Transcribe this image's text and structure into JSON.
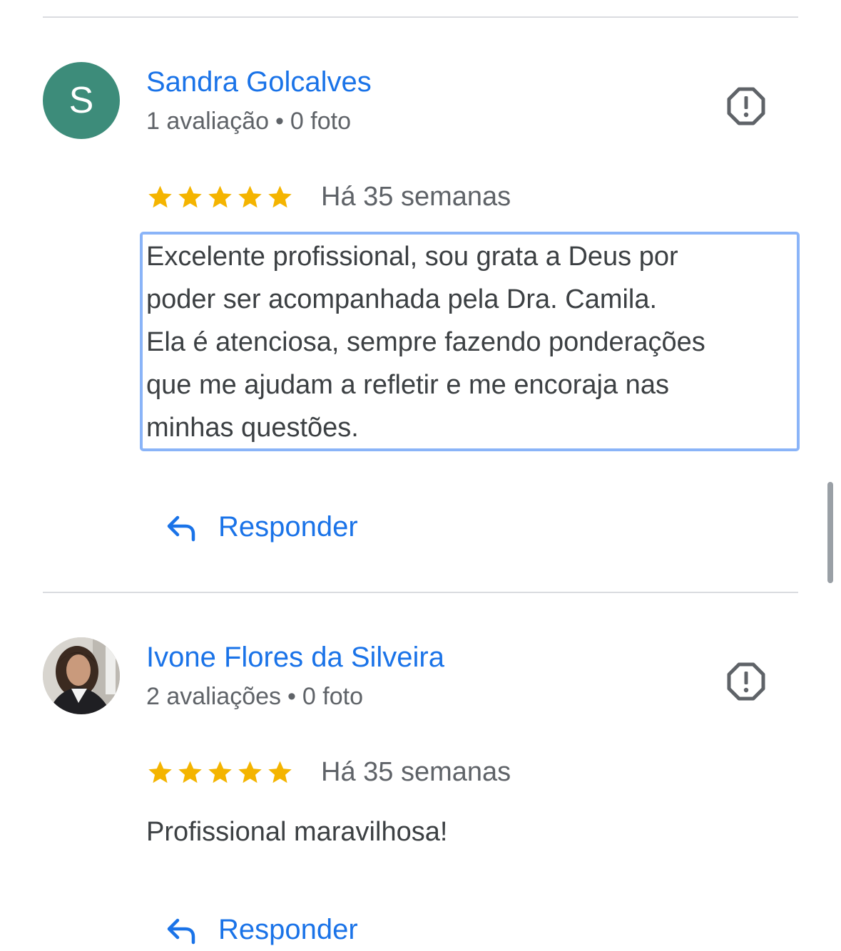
{
  "reviews": [
    {
      "reviewer_name": "Sandra Golcalves",
      "avatar_letter": "S",
      "avatar_color": "#3d8c7a",
      "reviews_count": "1 avaliação",
      "separator": "•",
      "photos_count": "0 foto",
      "rating": 5,
      "time_ago": "Há 35 semanas",
      "text_lines": [
        "Excelente profissional, sou grata a Deus por",
        "poder ser acompanhada pela Dra. Camila.",
        "Ela é atenciosa, sempre fazendo ponderações",
        "que me ajudam a refletir e me encoraja nas",
        "minhas questões."
      ],
      "reply_label": "Responder",
      "flag_icon": "flag-icon"
    },
    {
      "reviewer_name": "Ivone Flores da Silveira",
      "avatar_type": "photo",
      "reviews_count": "2 avaliações",
      "separator": "•",
      "photos_count": "0 foto",
      "rating": 5,
      "time_ago": "Há 35 semanas",
      "text_lines": [
        "Profissional maravilhosa!"
      ],
      "reply_label": "Responder",
      "flag_icon": "flag-icon"
    }
  ],
  "colors": {
    "link_blue": "#1a73e8",
    "star_yellow": "#f4b400",
    "focus_border": "#8ab4f8",
    "divider": "#dadce0"
  }
}
